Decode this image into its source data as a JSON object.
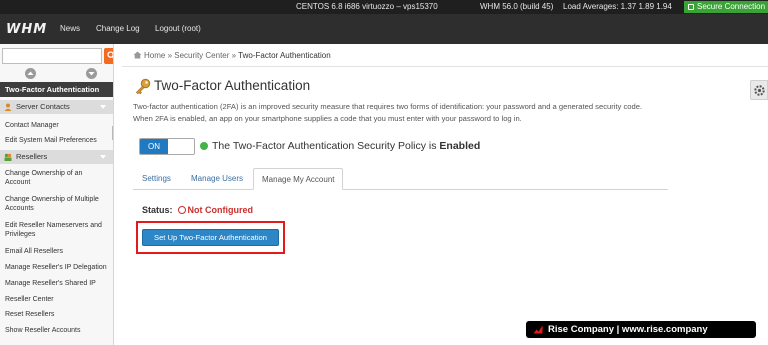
{
  "topbar": {
    "server_info": "CENTOS 6.8 i686 virtuozzo – vps15370",
    "whm_version": "WHM 56.0 (build 45)",
    "load_averages": "Load Averages: 1.37 1.89 1.94",
    "secure_label": "Secure Connection"
  },
  "navbar": {
    "logo": "WHM",
    "news": "News",
    "changelog": "Change Log",
    "logout": "Logout (root)"
  },
  "sidebar": {
    "search_placeholder": "",
    "active_item": "Two-Factor Authentication",
    "categories": [
      {
        "label": "Server Contacts"
      },
      {
        "label": "Resellers"
      }
    ],
    "server_contacts_items": [
      "Contact Manager",
      "Edit System Mail Preferences"
    ],
    "reseller_items": [
      "Change Ownership of an Account",
      "Change Ownership of Multiple Accounts",
      "Edit Reseller Nameservers and Privileges",
      "Email All Resellers",
      "Manage Reseller's IP Delegation",
      "Manage Reseller's Shared IP",
      "Reseller Center",
      "Reset Resellers",
      "Show Reseller Accounts"
    ]
  },
  "breadcrumb": {
    "home": "Home",
    "section": "Security Center",
    "current": "Two-Factor Authentication",
    "sep": "»"
  },
  "page": {
    "title": "Two-Factor Authentication",
    "description": "Two-factor authentication (2FA) is an improved security measure that requires two forms of identification: your password and a generated security code. When 2FA is enabled, an app on your smartphone supplies a code that you must enter with your password to log in.",
    "toggle_label": "ON",
    "policy_text": "The Two-Factor Authentication Security Policy is ",
    "policy_state": "Enabled",
    "tabs": [
      {
        "label": "Settings"
      },
      {
        "label": "Manage Users"
      },
      {
        "label": "Manage My Account"
      }
    ],
    "status_label": "Status:",
    "status_value": "Not Configured",
    "setup_button": "Set Up Two-Factor Authentication"
  },
  "banner": {
    "text": "Rise Company | www.rise.company"
  },
  "colors": {
    "accent_blue": "#2d86c6",
    "secure_green": "#3aa335",
    "enabled_green": "#46b34a",
    "error_red": "#c9302c",
    "highlight_red": "#e3191b",
    "search_orange": "#f36a21"
  }
}
